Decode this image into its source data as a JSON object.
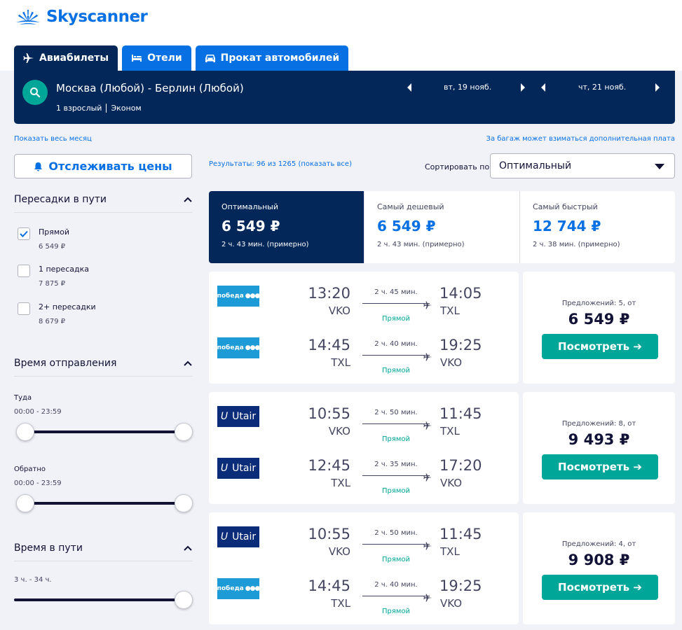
{
  "brand": {
    "name": "Skyscanner"
  },
  "tabs": [
    {
      "label": "Авиабилеты"
    },
    {
      "label": "Отели"
    },
    {
      "label": "Прокат автомобилей"
    }
  ],
  "search": {
    "route": "Москва (Любой) - Берлин (Любой)",
    "passengers": "1 взрослый",
    "cabin": "Эконом",
    "depart_date": "вт, 19 нояб.",
    "return_date": "чт, 21 нояб."
  },
  "links": {
    "whole_month": "Показать весь месяц",
    "baggage": "За багаж может взиматься дополнительная плата"
  },
  "sidebar": {
    "track_button": "Отслеживать цены",
    "stops": {
      "title": "Пересадки в пути",
      "options": [
        {
          "label": "Прямой",
          "price": "6 549 ₽",
          "checked": true
        },
        {
          "label": "1 пересадка",
          "price": "7 875 ₽",
          "checked": false
        },
        {
          "label": "2+ пересадки",
          "price": "8 679 ₽",
          "checked": false
        }
      ]
    },
    "departure_time": {
      "title": "Время отправления",
      "outbound_label": "Туда",
      "outbound_range": "00:00 - 23:59",
      "return_label": "Обратно",
      "return_range": "00:00 - 23:59"
    },
    "duration": {
      "title": "Время в пути",
      "range": "3 ч. - 34 ч."
    }
  },
  "results": {
    "count_text": "Результаты: 96 из 1265 (показать все)",
    "sort_label": "Сортировать по",
    "sort_value": "Оптимальный"
  },
  "summary": [
    {
      "title": "Оптимальный",
      "price": "6 549 ₽",
      "duration": "2 ч. 43 мин. (примерно)"
    },
    {
      "title": "Самый дешевый",
      "price": "6 549 ₽",
      "duration": "2 ч. 43 мин. (примерно)"
    },
    {
      "title": "Самый быстрый",
      "price": "12 744 ₽",
      "duration": "2 ч. 38 мин. (примерно)"
    }
  ],
  "flights": [
    {
      "offers": "Предложений: 5, от",
      "price": "6 549 ₽",
      "button": "Посмотреть ➔",
      "legs": [
        {
          "airline": "победа",
          "dep_time": "13:20",
          "dep_airport": "VKO",
          "duration": "2 ч. 45 мин.",
          "stops": "Прямой",
          "arr_time": "14:05",
          "arr_airport": "TXL"
        },
        {
          "airline": "победа",
          "dep_time": "14:45",
          "dep_airport": "TXL",
          "duration": "2 ч. 40 мин.",
          "stops": "Прямой",
          "arr_time": "19:25",
          "arr_airport": "VKO"
        }
      ]
    },
    {
      "offers": "Предложений: 8, от",
      "price": "9 493 ₽",
      "button": "Посмотреть ➔",
      "legs": [
        {
          "airline": "Utair",
          "dep_time": "10:55",
          "dep_airport": "VKO",
          "duration": "2 ч. 50 мин.",
          "stops": "Прямой",
          "arr_time": "11:45",
          "arr_airport": "TXL"
        },
        {
          "airline": "Utair",
          "dep_time": "12:45",
          "dep_airport": "TXL",
          "duration": "2 ч. 35 мин.",
          "stops": "Прямой",
          "arr_time": "17:20",
          "arr_airport": "VKO"
        }
      ]
    },
    {
      "offers": "Предложений: 4, от",
      "price": "9 908 ₽",
      "button": "Посмотреть ➔",
      "legs": [
        {
          "airline": "Utair",
          "dep_time": "10:55",
          "dep_airport": "VKO",
          "duration": "2 ч. 50 мин.",
          "stops": "Прямой",
          "arr_time": "11:45",
          "arr_airport": "TXL"
        },
        {
          "airline": "победа",
          "dep_time": "14:45",
          "dep_airport": "TXL",
          "duration": "2 ч. 40 мин.",
          "stops": "Прямой",
          "arr_time": "19:25",
          "arr_airport": "VKO"
        }
      ]
    }
  ]
}
